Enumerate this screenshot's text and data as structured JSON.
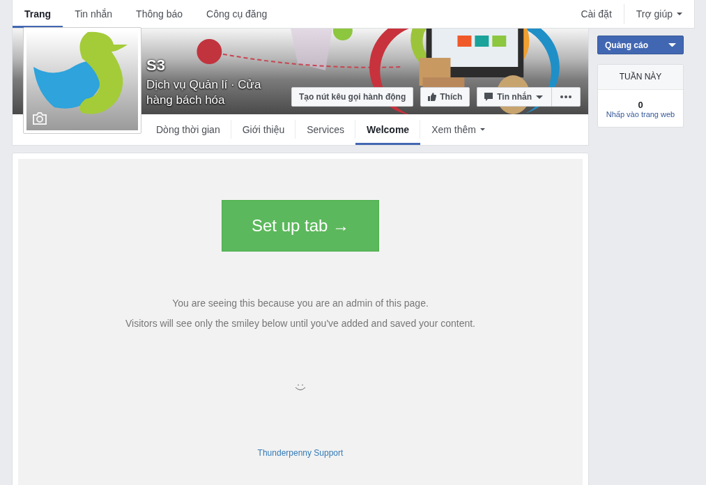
{
  "top_nav": {
    "tabs": [
      {
        "label": "Trang",
        "selected": true
      },
      {
        "label": "Tin nhắn",
        "selected": false
      },
      {
        "label": "Thông báo",
        "selected": false
      },
      {
        "label": "Công cụ đăng",
        "selected": false
      }
    ],
    "right": [
      {
        "label": "Cài đặt",
        "has_menu": false
      },
      {
        "label": "Trợ giúp",
        "has_menu": true
      }
    ]
  },
  "page": {
    "name": "S3",
    "category": "Dịch vụ Quản lí · Cửa hàng bách hóa",
    "actions": [
      {
        "kind": "button",
        "label": "Tạo nút kêu gọi hành động"
      },
      {
        "kind": "like",
        "label": "Thích"
      },
      {
        "kind": "message",
        "label": "Tin nhắn"
      },
      {
        "kind": "more"
      }
    ]
  },
  "page_tabs": [
    {
      "label": "Dòng thời gian",
      "selected": false,
      "has_menu": false
    },
    {
      "label": "Giới thiệu",
      "selected": false,
      "has_menu": false
    },
    {
      "label": "Services",
      "selected": false,
      "has_menu": false
    },
    {
      "label": "Welcome",
      "selected": true,
      "has_menu": false
    },
    {
      "label": "Xem thêm",
      "selected": false,
      "has_menu": true
    }
  ],
  "tab_content": {
    "button": "Set up tab →",
    "notices": [
      "You are seeing this because you are an admin of this page.",
      "Visitors will see only the smiley below until you've added and saved your content."
    ],
    "link": "Thunderpenny Support"
  },
  "sidebar": {
    "ad_button": "Quảng cáo",
    "stats": {
      "title": "TUẦN NÀY",
      "value": "0",
      "label": "Nhấp vào trang web"
    }
  }
}
